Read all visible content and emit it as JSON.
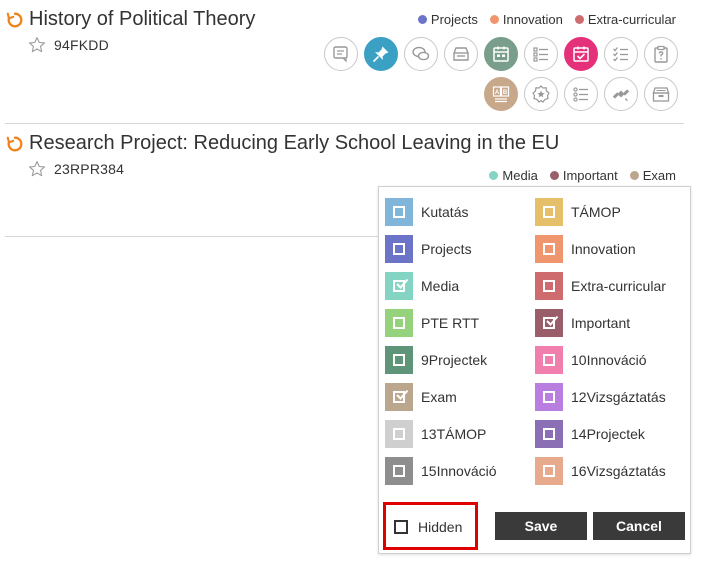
{
  "courses": [
    {
      "title": "History of Political Theory",
      "code": "94FKDD",
      "tags": [
        {
          "label": "Projects",
          "color": "#6b74c7"
        },
        {
          "label": "Innovation",
          "color": "#f0966e"
        },
        {
          "label": "Extra-curricular",
          "color": "#cd6b6f"
        }
      ]
    },
    {
      "title": "Research Project: Reducing Early School Leaving in the EU",
      "code": "23RPR384",
      "tags": [
        {
          "label": "Media",
          "color": "#84d4c4"
        },
        {
          "label": "Important",
          "color": "#9a5e6a"
        },
        {
          "label": "Exam",
          "color": "#bba78e"
        }
      ]
    }
  ],
  "toolbar_icons": [
    "forum-post-icon",
    "pin-icon",
    "chat-icon",
    "inbox-tray-icon",
    "calendar-icon",
    "list-icon",
    "calendar-check-icon",
    "checklist-icon",
    "clipboard-question-icon",
    "ab-test-icon",
    "badge-star-icon",
    "list-alt-icon",
    "satellite-icon",
    "archive-icon"
  ],
  "label_picker": {
    "left_column": [
      {
        "label": "Kutatás",
        "color": "#7fb6d9",
        "checked": false
      },
      {
        "label": "Projects",
        "color": "#6b74c7",
        "checked": false
      },
      {
        "label": "Media",
        "color": "#84d4c4",
        "checked": true
      },
      {
        "label": "PTE RTT",
        "color": "#95d27c",
        "checked": false
      },
      {
        "label": "9Projectek",
        "color": "#5e9478",
        "checked": false
      },
      {
        "label": "Exam",
        "color": "#bba78e",
        "checked": true
      },
      {
        "label": "13TÁMOP",
        "color": "#cfcfcf",
        "checked": false
      },
      {
        "label": "15Innováció",
        "color": "#8e8e8e",
        "checked": false
      }
    ],
    "right_column": [
      {
        "label": "TÁMOP",
        "color": "#e6bf6a",
        "checked": false
      },
      {
        "label": "Innovation",
        "color": "#f0966e",
        "checked": false
      },
      {
        "label": "Extra-curricular",
        "color": "#cd6b6f",
        "checked": false
      },
      {
        "label": "Important",
        "color": "#9a5e6a",
        "checked": true
      },
      {
        "label": "10Innováció",
        "color": "#f07fae",
        "checked": false
      },
      {
        "label": "12Vizsgáztatás",
        "color": "#b87fe0",
        "checked": false
      },
      {
        "label": "14Projectek",
        "color": "#8a6fb4",
        "checked": false
      },
      {
        "label": "16Vizsgáztatás",
        "color": "#e8aa8c",
        "checked": false
      }
    ],
    "hidden_label": "Hidden",
    "hidden_checked": false,
    "save_label": "Save",
    "cancel_label": "Cancel"
  }
}
